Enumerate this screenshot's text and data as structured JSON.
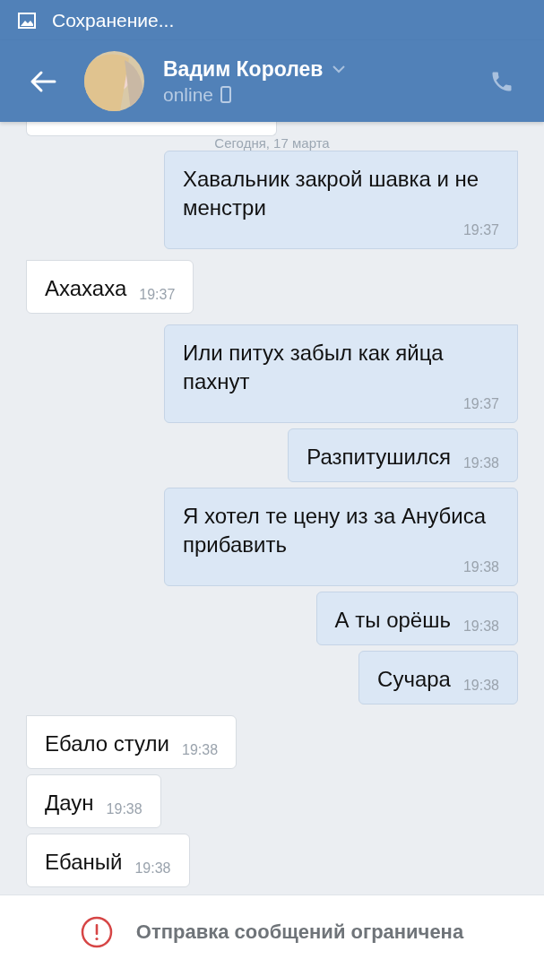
{
  "status_bar": {
    "notification": "Сохранение..."
  },
  "header": {
    "name": "Вадим Королев",
    "status": "online"
  },
  "date_separator": "Сегодня, 17 марта",
  "messages": [
    {
      "outgoing": true,
      "first_in_group": true,
      "text": "Хавальник закрой шавка и не менстри",
      "time": "19:37"
    },
    {
      "outgoing": false,
      "first_in_group": true,
      "text": "Ахахаха",
      "time": "19:37"
    },
    {
      "outgoing": true,
      "first_in_group": true,
      "text": "Или питух забыл как яйца пахнут",
      "time": "19:37"
    },
    {
      "outgoing": true,
      "first_in_group": false,
      "text": "Разпитушился",
      "time": "19:38"
    },
    {
      "outgoing": true,
      "first_in_group": false,
      "text": "Я хотел те цену из за Анубиса прибавить",
      "time": "19:38"
    },
    {
      "outgoing": true,
      "first_in_group": false,
      "text": "А ты орёшь",
      "time": "19:38"
    },
    {
      "outgoing": true,
      "first_in_group": false,
      "text": "Сучара",
      "time": "19:38"
    },
    {
      "outgoing": false,
      "first_in_group": true,
      "text": "Ебало стули",
      "time": "19:38"
    },
    {
      "outgoing": false,
      "first_in_group": false,
      "text": "Даун",
      "time": "19:38"
    },
    {
      "outgoing": false,
      "first_in_group": false,
      "text": "Ебаный",
      "time": "19:38"
    }
  ],
  "footer": {
    "notice": "Отправка сообщений ограничена"
  }
}
